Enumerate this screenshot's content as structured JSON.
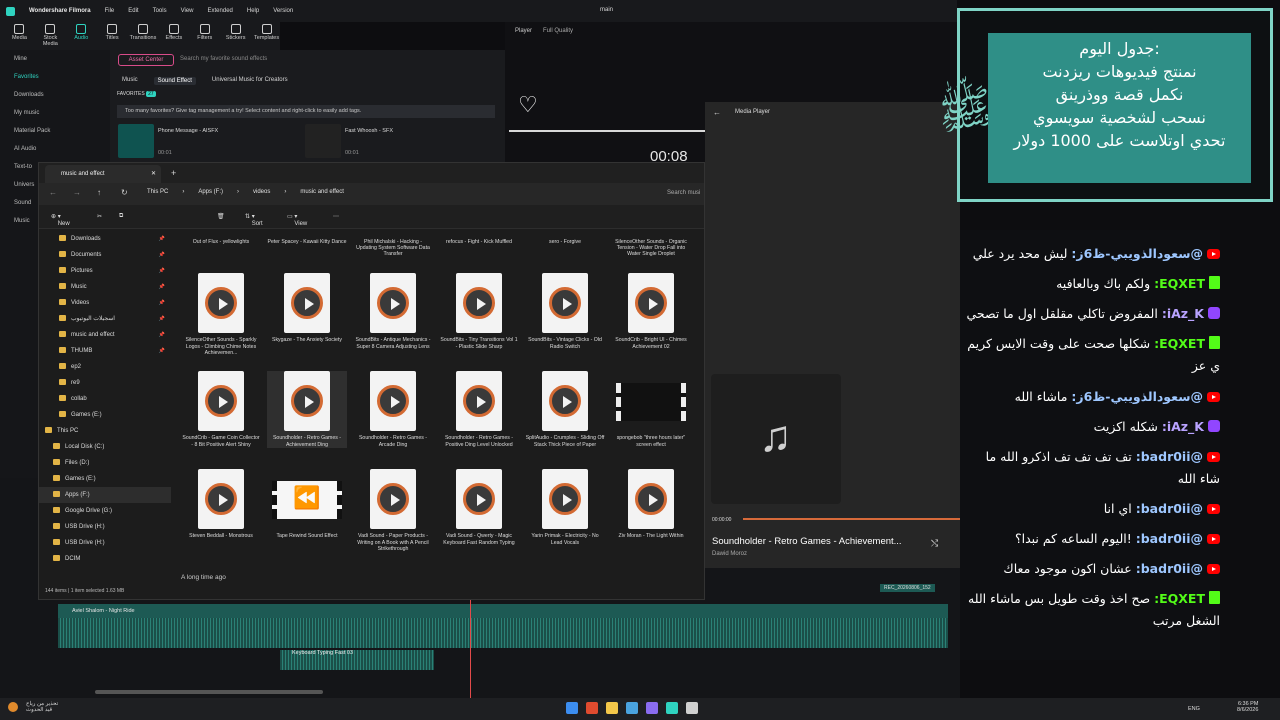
{
  "filmora": {
    "app_title": "Wondershare Filmora",
    "menu": [
      "File",
      "Edit",
      "Tools",
      "View",
      "Extended",
      "Help",
      "Version"
    ],
    "project": "main",
    "toolbar": [
      "Media",
      "Stock Media",
      "Audio",
      "Titles",
      "Transitions",
      "Effects",
      "Filters",
      "Stickers",
      "Templates"
    ],
    "sidebar": [
      "Mine",
      "Favorites",
      "Downloads",
      "My music",
      "Material Pack",
      "AI Audio",
      "Text-to",
      "Univers",
      "Sound",
      "Music"
    ],
    "asset_center": "Asset Center",
    "search_placeholder": "Search my favorite sound effects",
    "tabs": [
      "Music",
      "Sound Effect",
      "Universal Music for Creators"
    ],
    "favorites_label": "FAVORITES",
    "favorites_count": "27",
    "banner": "Too many favorites? Give tag management a try! Select content and right-click to easily add tags.",
    "sounds": [
      {
        "name": "Phone Message - AISFX",
        "time": "00:01"
      },
      {
        "name": "Fast Whoosh - SFX",
        "time": "00:01"
      }
    ],
    "player_label": "Player",
    "quality": "Full Quality",
    "timecode": "00:08"
  },
  "explorer": {
    "tab_title": "music and effect",
    "breadcrumb": [
      "This PC",
      "Apps (F:)",
      "videos",
      "music and effect"
    ],
    "search": "Search musi",
    "commands": [
      "New",
      "Sort",
      "View"
    ],
    "nav": [
      {
        "label": "Downloads",
        "pin": true
      },
      {
        "label": "Documents",
        "pin": true
      },
      {
        "label": "Pictures",
        "pin": true
      },
      {
        "label": "Music",
        "pin": true
      },
      {
        "label": "Videos",
        "pin": true
      },
      {
        "label": "اسجيلات اليوتيوب",
        "pin": true
      },
      {
        "label": "music and effect",
        "pin": true
      },
      {
        "label": "THUMB",
        "pin": true
      },
      {
        "label": "ep2",
        "pin": false
      },
      {
        "label": "re9",
        "pin": false
      },
      {
        "label": "collab",
        "pin": false
      },
      {
        "label": "Games (E:)",
        "pin": false
      },
      {
        "label": "This PC",
        "pin": false
      },
      {
        "label": "Local Disk (C:)",
        "pin": false
      },
      {
        "label": "Files (D:)",
        "pin": false
      },
      {
        "label": "Games (E:)",
        "pin": false
      },
      {
        "label": "Apps (F:)",
        "pin": false
      },
      {
        "label": "Google Drive (G:)",
        "pin": false
      },
      {
        "label": "USB Drive (H:)",
        "pin": false
      },
      {
        "label": "USB Drive (H:)",
        "pin": false
      },
      {
        "label": "DCIM",
        "pin": false
      }
    ],
    "top_row": [
      "Out of Flux - yellowlights",
      "Peter Spacey - Kawaii Kitty Dance",
      "Phil Michalski - Hacking - Updating System Software Data Transfer",
      "refocus - Fight - Kick Muffled",
      "sero - Forgive",
      "SilenceOther Sounds - Organic Tension - Water Drop Fall into Water Single Droplet"
    ],
    "row2": [
      "SilenceOther Sounds - Sparkly Logos - Climbing Chime Notes Achievemen...",
      "Skygaze - The Anxiety Society",
      "SoundBits - Antique Mechanics - Super 8 Camera Adjusting Lens",
      "SoundBits - Tiny Transitions Vol 1 - Plastic Slide Sharp",
      "SoundBits - Vintage Clicks - Old Radio Switch",
      "SoundCrib - Bright UI - Chimes Achievement 02"
    ],
    "row3": [
      "SoundCrib - Game Coin Collector - 8 Bit Positive Alert Shiny",
      "Soundholder - Retro Games - Achievement Ding",
      "Soundholder - Retro Games - Arcade Ding",
      "Soundholder - Retro Games - Positive Ding Level Unlocked",
      "SplitAudio - Crumples - Sliding Off Stack Thick Piece of Paper",
      "spongebob \"three hours later\" screen effect"
    ],
    "row4": [
      "Steven Beddall - Monstrous",
      "Tape Rewind Sound Effect",
      "Vadi Sound - Paper Products - Writing on A Book with A Pencil Strikethrough",
      "Vadi Sound - Qwerty - Magic Keyboard Fast Random Typing",
      "Yarin Primak - Electricity - No Lead Vocals",
      "Ziv Moran - The Light Within"
    ],
    "group_label": "A long time ago",
    "status": "144 items | 1 item selected 1.63 MB"
  },
  "media_player": {
    "title": "Media Player",
    "position": "00:00:00",
    "song": "Soundholder - Retro Games - Achievement...",
    "artist": "Dawid Moroz"
  },
  "timeline": {
    "clip_top": "Aviel Shalom - Night Ride",
    "clip_bottom": "Keyboard Typing Fast 03",
    "rec_label": "REC_20260806_152"
  },
  "schedule": {
    "lines": [
      "جدول اليوم:",
      "نمنتج فيديوهات ريزدنت",
      "نكمل قصة ووذرينق",
      "نسحب لشخصية سويسوي",
      "تحدي اوتلاست على 1000 دولار"
    ]
  },
  "chat": [
    {
      "platform": "yt",
      "user": "@سعودالذويبي-ظ6ز:",
      "text": "ليش محد يرد علي"
    },
    {
      "platform": "kick",
      "user": "EQXET:",
      "text": "ولكم باك وبالعافيه"
    },
    {
      "platform": "twitch",
      "user": "iAz_K:",
      "text": "المفروض تاكلي مقلقل اول ما تصحي"
    },
    {
      "platform": "kick",
      "user": "EQXET:",
      "text": "شكلها صحت على وقت الايس كريم ي عز"
    },
    {
      "platform": "yt",
      "user": "@سعودالذويبي-ظ6ز:",
      "text": "ماشاء الله"
    },
    {
      "platform": "twitch",
      "user": "iAz_K:",
      "text": "شكله اكزيت"
    },
    {
      "platform": "yt",
      "user": "@badr0ii:",
      "text": "تف تف تف تف اذكرو الله ما شاء الله"
    },
    {
      "platform": "yt",
      "user": "@badr0ii:",
      "text": "اي انا"
    },
    {
      "platform": "yt",
      "user": "@badr0ii:",
      "text": "!اليوم الساعه كم نبدا؟"
    },
    {
      "platform": "yt",
      "user": "@badr0ii:",
      "text": "عشان اكون موجود معاك"
    },
    {
      "platform": "kick",
      "user": "EQXET:",
      "text": "صح اخذ وقت طويل بس ماشاء الله الشغل مرتب"
    }
  ],
  "taskbar": {
    "weather_line1": "تحذير من رياح",
    "weather_line2": "قيد الحدوث",
    "lang": "ENG",
    "time": "6:36 PM",
    "date": "8/6/2026"
  }
}
